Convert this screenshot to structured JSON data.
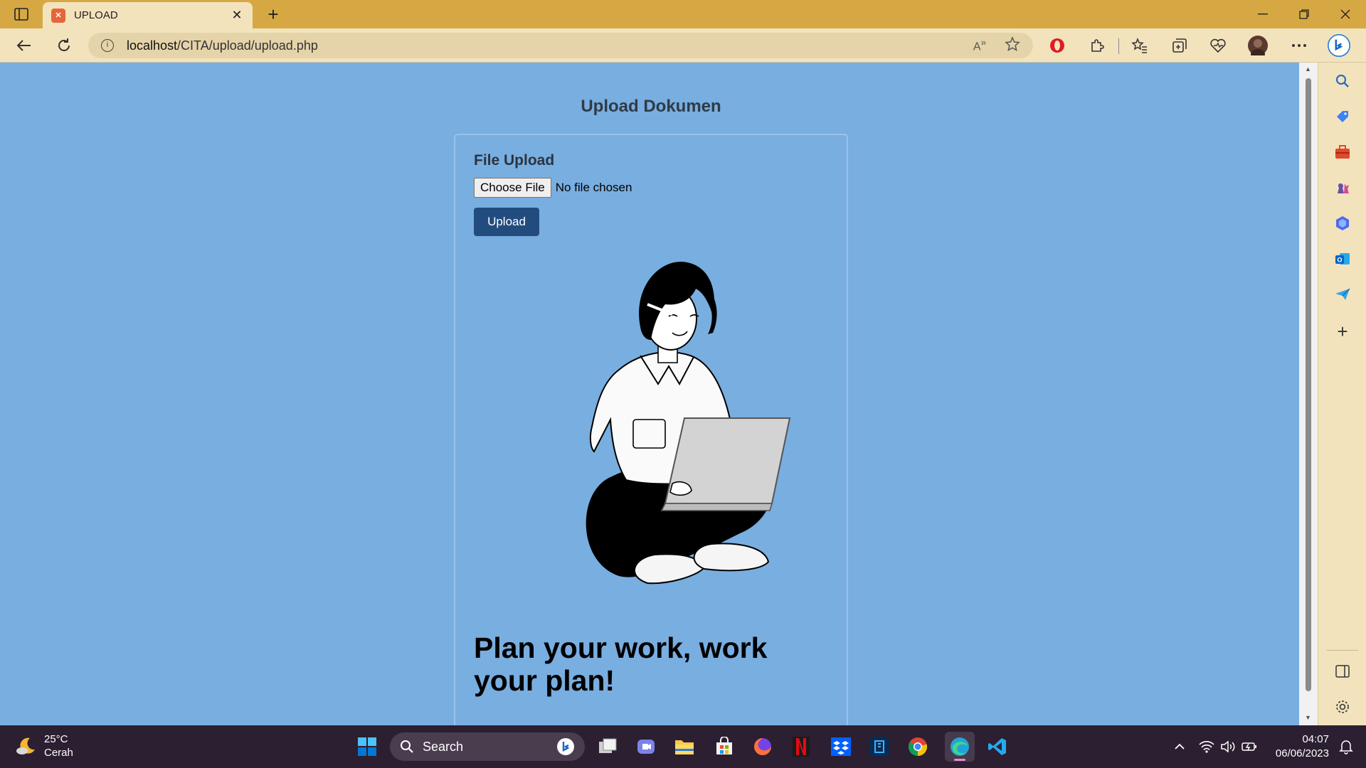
{
  "browser": {
    "tab_title": "UPLOAD",
    "url_host": "localhost",
    "url_path": "/CITA/upload/upload.php"
  },
  "page": {
    "title": "Upload Dokumen",
    "upload_label": "File Upload",
    "choose_file_label": "Choose File",
    "no_file_text": "No file chosen",
    "upload_button": "Upload",
    "tagline": "Plan your work, work your plan!"
  },
  "taskbar": {
    "weather_temp": "25°C",
    "weather_desc": "Cerah",
    "search_label": "Search",
    "time": "04:07",
    "date": "06/06/2023"
  },
  "colors": {
    "page_bg": "#79aee0",
    "button_bg": "#234c7e",
    "browser_frame": "#d6a843"
  }
}
